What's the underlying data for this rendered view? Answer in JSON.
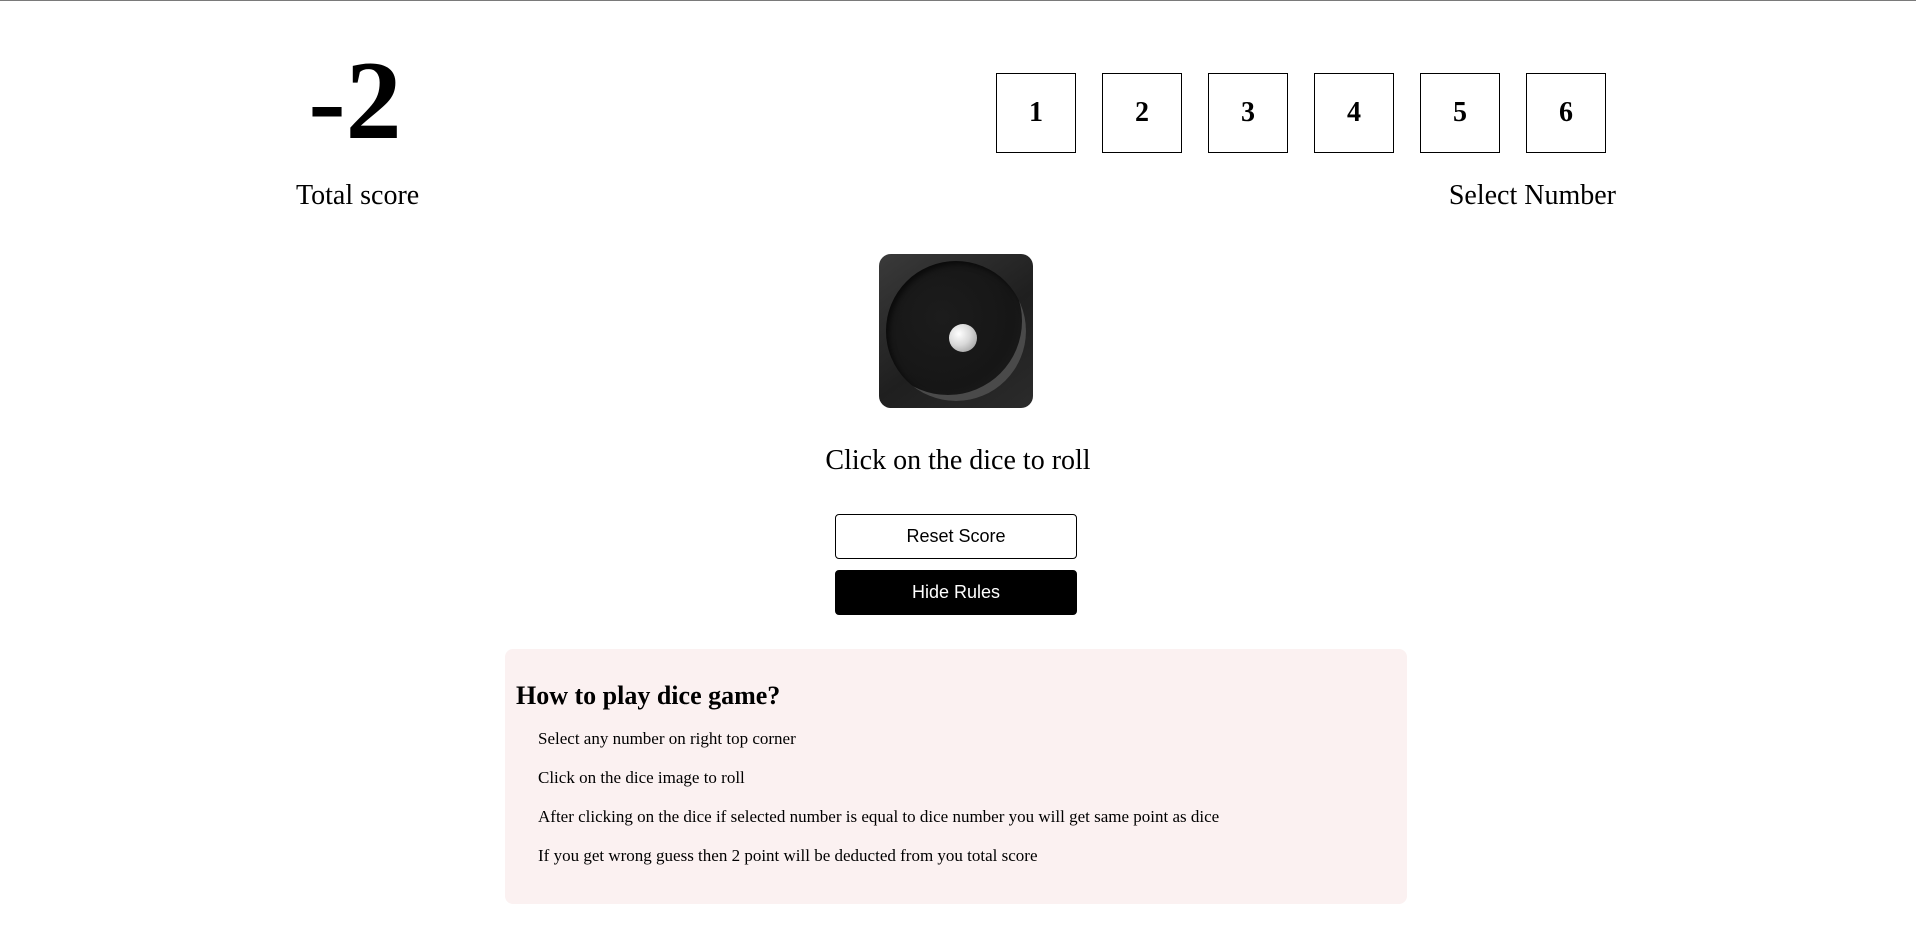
{
  "score": {
    "value": "-2",
    "label": "Total score"
  },
  "number_selector": {
    "options": [
      "1",
      "2",
      "3",
      "4",
      "5",
      "6"
    ],
    "label": "Select Number"
  },
  "dice": {
    "current_face": 1,
    "hint": "Click on the dice to roll"
  },
  "buttons": {
    "reset_label": "Reset Score",
    "hide_rules_label": "Hide Rules"
  },
  "rules": {
    "title": "How to play dice game?",
    "items": [
      "Select any number on right top corner",
      "Click on the dice image to roll",
      "After clicking on the dice if selected number is equal to dice number you will get same point as dice",
      "If you get wrong guess then 2 point will be deducted from you total score"
    ]
  }
}
